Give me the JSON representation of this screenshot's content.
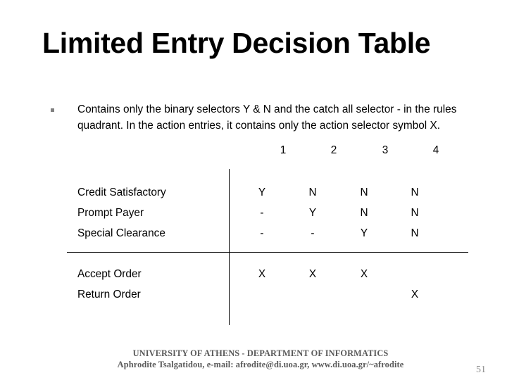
{
  "slide": {
    "title": "Limited Entry Decision Table",
    "page_number": "51"
  },
  "bullet": {
    "marker": "square-bullet-icon",
    "text": "Contains only the binary selectors Y & N and the catch all selector - in the rules quadrant. In the action entries, it contains only the action selector symbol X."
  },
  "decision_table": {
    "column_headers": [
      "1",
      "2",
      "3",
      "4"
    ],
    "condition_rows": [
      {
        "label": "Credit Satisfactory",
        "values": [
          "Y",
          "N",
          "N",
          "N"
        ]
      },
      {
        "label": "Prompt Payer",
        "values": [
          "-",
          "Y",
          "N",
          "N"
        ]
      },
      {
        "label": "Special Clearance",
        "values": [
          "-",
          "-",
          "Y",
          "N"
        ]
      }
    ],
    "action_rows": [
      {
        "label": "Accept Order",
        "values": [
          "X",
          "X",
          "X",
          ""
        ]
      },
      {
        "label": "Return Order",
        "values": [
          "",
          "",
          "",
          "X"
        ]
      }
    ]
  },
  "footer": {
    "line1": "UNIVERSITY OF ATHENS - DEPARTMENT OF INFORMATICS",
    "line2": "Aphrodite Tsalgatidou, e-mail: afrodite@di.uoa.gr, www.di.uoa.gr/~afrodite"
  },
  "colors": {
    "text": "#000000",
    "bullet_marker": "#808080",
    "footer_text": "#5a5a5a",
    "page_number": "#8c8c8c",
    "rule": "#000000",
    "background": "#ffffff"
  }
}
